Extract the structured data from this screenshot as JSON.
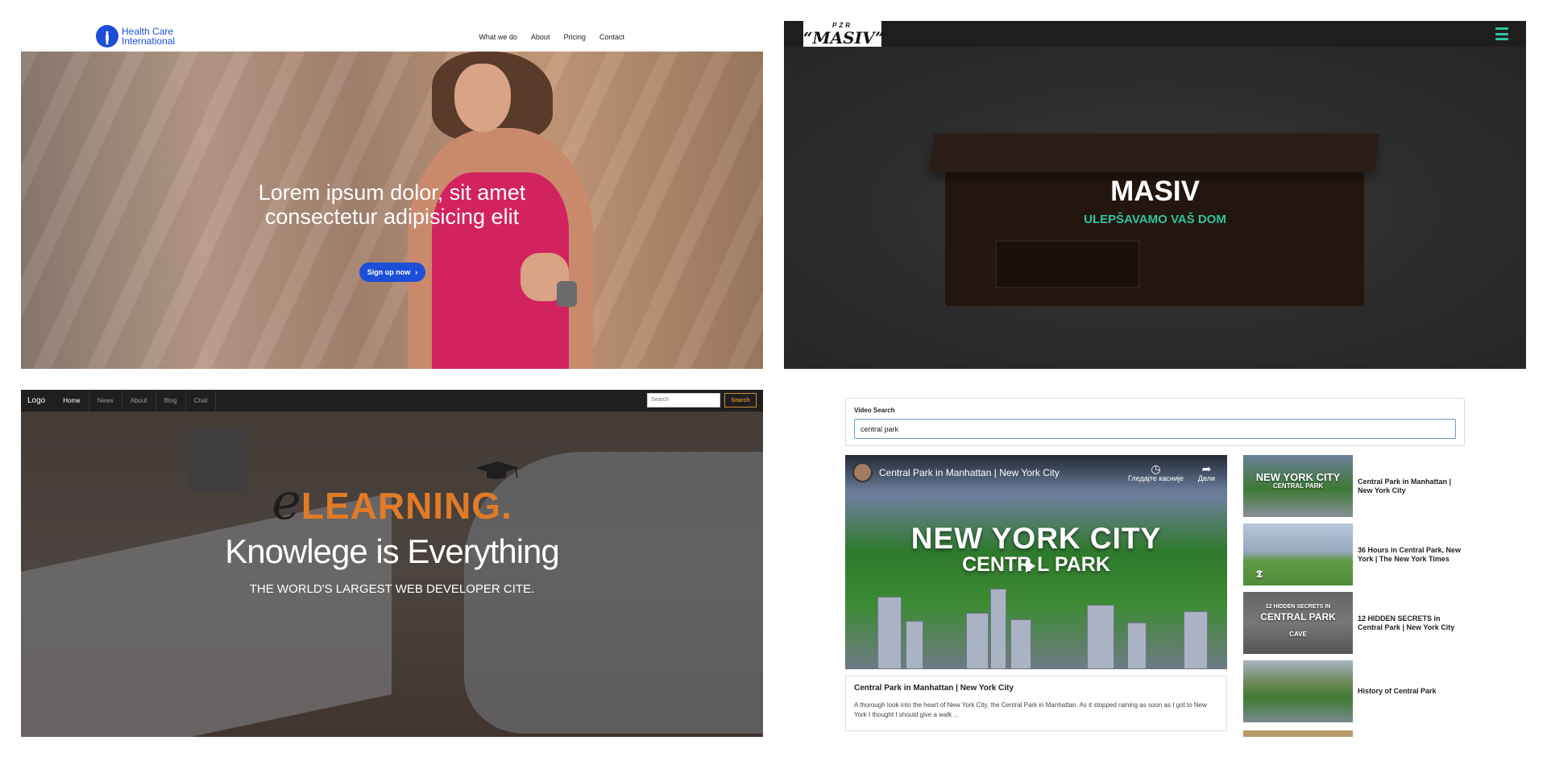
{
  "panel1": {
    "logo": {
      "line1": "Health Care",
      "line2": "International"
    },
    "nav": [
      "What we do",
      "About",
      "Pricing",
      "Contact"
    ],
    "hero": {
      "line1": "Lorem ipsum dolor, sit amet",
      "line2": "consectetur adipisicing elit"
    },
    "cta": "Sign up now",
    "colors": {
      "brand": "#1d4ed8"
    }
  },
  "panel2": {
    "logo": {
      "top": "PZR",
      "main": "“MASIV”"
    },
    "title": "MASIV",
    "subtitle": "ULEPŠAVAMO VAŠ DOM",
    "colors": {
      "accent": "#2ec4a0",
      "nav": "#1e1e1e"
    }
  },
  "panel3": {
    "brand": "Logo",
    "nav": [
      "Home",
      "News",
      "About",
      "Blog",
      "Chat"
    ],
    "active": "Home",
    "search": {
      "placeholder": "Search",
      "button": "Search"
    },
    "logo_e": "e",
    "logo_word": "LEARNING",
    "logo_dot": ".",
    "title": "Knowlege is Everything",
    "subtitle": "THE WORLD'S LARGEST WEB DEVELOPER CITE.",
    "colors": {
      "accent": "#e17b26"
    }
  },
  "panel4": {
    "search_label": "Video Search",
    "search_value": "central park",
    "player": {
      "title": "Central Park in Manhattan | New York City",
      "watch_later": "Гледајте касније",
      "share": "Дели",
      "overlay1": "NEW YORK CITY",
      "overlay2": "CENTR  L PARK"
    },
    "detail": {
      "title": "Central Park in Manhattan | New York City",
      "description": "A thorough look into the heart of New York City, the Central Park in Manhattan. As it stopped raining as soon as I got to New York I thought I should give a walk ..."
    },
    "list": [
      {
        "label": "Central Park in Manhattan | New York City",
        "thumb_line1": "NEW YORK CITY",
        "thumb_line2": "CENTRAL PARK"
      },
      {
        "label": "36 Hours in Central Park, New York | The New York Times",
        "thumb_line1": "",
        "thumb_line2": ""
      },
      {
        "label": "12 HIDDEN SECRETS in Central Park | New York City",
        "thumb_line1": "12 HIDDEN SECRETS IN",
        "thumb_line2": "CENTRAL PARK",
        "thumb_line3": "CAVE"
      },
      {
        "label": "History of Central Park",
        "thumb_line1": "",
        "thumb_line2": ""
      }
    ],
    "icons": {
      "watch_later": "clock-icon",
      "share": "share-icon",
      "play": "play-icon"
    }
  }
}
